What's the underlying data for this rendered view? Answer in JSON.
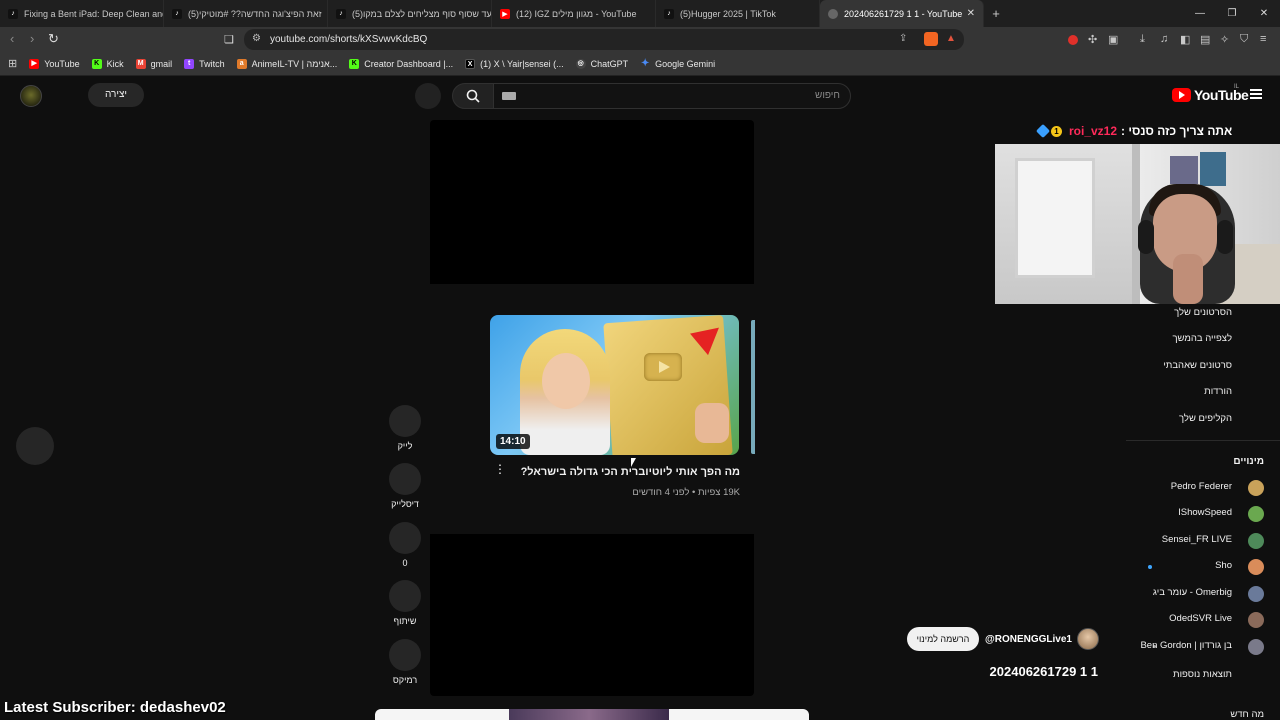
{
  "browser": {
    "tabs": [
      {
        "title": "Fixing a Bent iPad: Deep Clean and R",
        "icon": "tiktok-icon",
        "active": false
      },
      {
        "title": "(5)זאת הפיצ'וגה החדשה?? #מוטיקי",
        "icon": "tiktok-icon",
        "active": false
      },
      {
        "title": "(5)עד שסוף סוף מצליחים לצלם במקו",
        "icon": "tiktok-icon",
        "active": false
      },
      {
        "title": "(12) IGZ מגוון מילים - YouTube",
        "icon": "youtube-icon",
        "active": false
      },
      {
        "title": "(5)Hugger 2025 | TikTok",
        "icon": "tiktok-icon",
        "active": false
      },
      {
        "title": "202406261729 1 1 - YouTube",
        "icon": "globe-icon",
        "active": true
      }
    ],
    "new_tab": "+",
    "url": "youtube.com/shorts/kXSvwvKdcBQ",
    "bookmarks": [
      {
        "label": "YouTube",
        "icon": "youtube-icon",
        "color": "#ff0000"
      },
      {
        "label": "Kick",
        "icon": "kick-icon",
        "color": "#53fc18"
      },
      {
        "label": "gmail",
        "icon": "gmail-icon",
        "color": "#ea4335"
      },
      {
        "label": "Twitch",
        "icon": "twitch-icon",
        "color": "#9146ff"
      },
      {
        "label": "AnimeIL-TV | אנימה...",
        "icon": "anime-icon",
        "color": "#e07a2a"
      },
      {
        "label": "Creator Dashboard |...",
        "icon": "kick-icon",
        "color": "#53fc18"
      },
      {
        "label": "(1) X \\ Yair|sensei (...",
        "icon": "x-icon",
        "color": "#000000"
      },
      {
        "label": "ChatGPT",
        "icon": "chatgpt-icon",
        "color": "#444444"
      },
      {
        "label": "Google Gemini",
        "icon": "gemini-icon",
        "color": "#4a8af4"
      }
    ]
  },
  "header": {
    "create_label": "יצירה",
    "search_placeholder": "חיפוש",
    "logo_text": "YouTube",
    "logo_region": "IL"
  },
  "short": {
    "title": "מה הפך אותי ליוטיוברית הכי גדולה בישראל?",
    "meta": "19K צפיות • לפני 4 חודשים",
    "duration": "14:10",
    "actions": [
      {
        "name": "like",
        "label": "לייק"
      },
      {
        "name": "dislike",
        "label": "דיסלייק"
      },
      {
        "name": "comments",
        "label": "0"
      },
      {
        "name": "share",
        "label": "שיתוף"
      },
      {
        "name": "remix",
        "label": "רמיקס"
      }
    ]
  },
  "overlay": {
    "prefix": "אתה צריך כזה סנסי :",
    "username": "roi_vz12",
    "badge": "1",
    "latest_subscriber": "Latest Subscriber: dedashev02"
  },
  "right_sidebar": {
    "links": [
      "הסרטונים שלך",
      "לצפייה בהמשך",
      "סרטונים שאהבתי",
      "הורדות",
      "הקליפים שלך"
    ],
    "subs_heading": "מינויים",
    "subscriptions": [
      {
        "name": "Pedro Federer",
        "avatar_color": "#c9a25a",
        "live": false,
        "new": false
      },
      {
        "name": "IShowSpeed",
        "avatar_color": "#6aa84f",
        "live": false,
        "new": false
      },
      {
        "name": "Sensei_FR LIVE",
        "avatar_color": "#4e8a5a",
        "live": false,
        "new": false
      },
      {
        "name": "Sho",
        "avatar_color": "#d98c5a",
        "live": false,
        "new": true
      },
      {
        "name": "עומר ביג - Omerbig",
        "avatar_color": "#6a7a9a",
        "live": false,
        "new": false
      },
      {
        "name": "OdedSVR Live",
        "avatar_color": "#8a6a5a",
        "live": false,
        "new": false
      },
      {
        "name": "Ben Gordon | בן גורדון",
        "avatar_color": "#7a7a8a",
        "live": true,
        "new": false
      }
    ],
    "more_results": "תוצאות נוספות",
    "new_label": "מה חדש"
  },
  "channel": {
    "subscribe_label": "הרשמה למינוי",
    "handle": "@RONENGGLive1",
    "stream_title": "202406261729 1 1"
  }
}
